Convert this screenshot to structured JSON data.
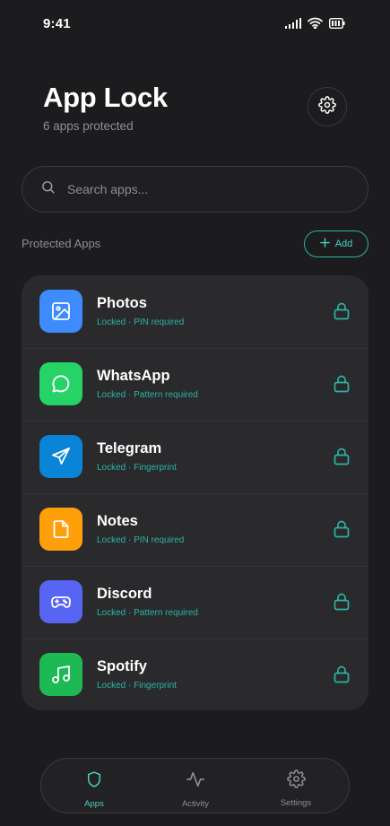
{
  "status_bar": {
    "time": "9:41"
  },
  "header": {
    "title": "App Lock",
    "subtitle": "6 apps protected"
  },
  "search": {
    "placeholder": "Search apps..."
  },
  "section": {
    "title": "Protected Apps",
    "add_label": "Add"
  },
  "apps": [
    {
      "name": "Photos",
      "status": "Locked · PIN required",
      "icon": "image-icon",
      "color": "#3d8bfd"
    },
    {
      "name": "WhatsApp",
      "status": "Locked · Pattern required",
      "icon": "chat-bubble-icon",
      "color": "#25d366"
    },
    {
      "name": "Telegram",
      "status": "Locked · Fingerprint",
      "icon": "paper-plane-icon",
      "color": "#0a84d6"
    },
    {
      "name": "Notes",
      "status": "Locked · PIN required",
      "icon": "document-icon",
      "color": "#ff9f0a"
    },
    {
      "name": "Discord",
      "status": "Locked · Pattern required",
      "icon": "gamepad-icon",
      "color": "#5865f2"
    },
    {
      "name": "Spotify",
      "status": "Locked · Fingerprint",
      "icon": "music-note-icon",
      "color": "#1db954"
    }
  ],
  "nav": [
    {
      "label": "Apps",
      "icon": "shield-icon",
      "active": true
    },
    {
      "label": "Activity",
      "icon": "activity-icon",
      "active": false
    },
    {
      "label": "Settings",
      "icon": "gear-icon",
      "active": false
    }
  ],
  "colors": {
    "accent": "#2bb3a4",
    "background": "#1c1c1e",
    "card": "#2a2a2c"
  }
}
